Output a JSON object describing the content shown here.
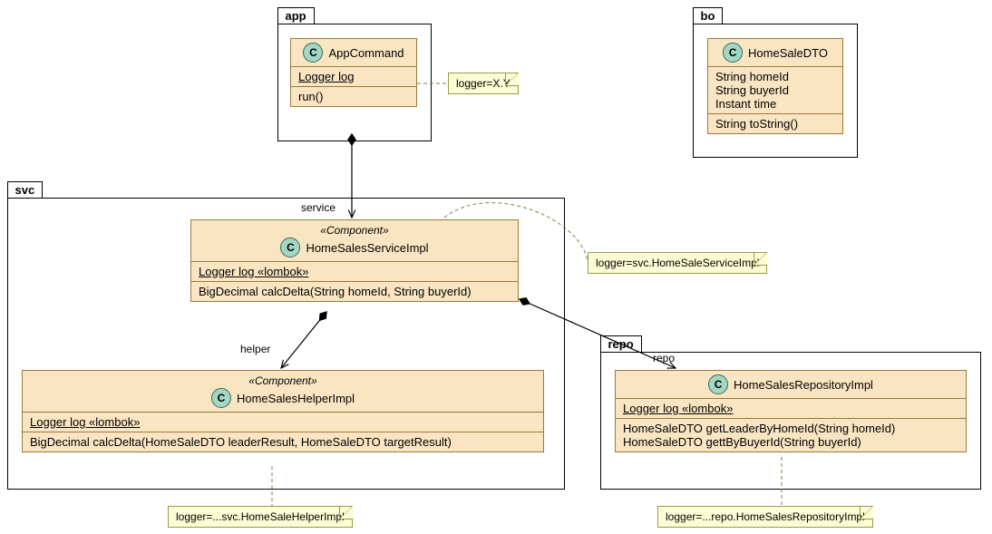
{
  "packages": {
    "app": {
      "label": "app"
    },
    "bo": {
      "label": "bo"
    },
    "svc": {
      "label": "svc"
    },
    "repo": {
      "label": "repo"
    }
  },
  "classes": {
    "AppCommand": {
      "name": "AppCommand",
      "attrs": [
        "Logger log"
      ],
      "ops": [
        "run()"
      ]
    },
    "HomeSaleDTO": {
      "name": "HomeSaleDTO",
      "attrs": [
        "String homeId",
        "String buyerId",
        "Instant time"
      ],
      "ops": [
        "String toString()"
      ]
    },
    "HomeSalesServiceImpl": {
      "stereo": "«Component»",
      "name": "HomeSalesServiceImpl",
      "attrs": [
        "Logger log «lombok»"
      ],
      "ops": [
        "BigDecimal calcDelta(String homeId, String buyerId)"
      ]
    },
    "HomeSalesHelperImpl": {
      "stereo": "«Component»",
      "name": "HomeSalesHelperImpl",
      "attrs": [
        "Logger log «lombok»"
      ],
      "ops": [
        "BigDecimal calcDelta(HomeSaleDTO leaderResult, HomeSaleDTO targetResult)"
      ]
    },
    "HomeSalesRepositoryImpl": {
      "name": "HomeSalesRepositoryImpl",
      "attrs": [
        "Logger log  «lombok»"
      ],
      "ops": [
        "HomeSaleDTO getLeaderByHomeId(String homeId)",
        "HomeSaleDTO gettByBuyerId(String buyerId)"
      ]
    }
  },
  "notes": {
    "n_app": "logger=X.Y",
    "n_svc": "logger=svc.HomeSaleServiceImpl",
    "n_helper": "logger=...svc.HomeSaleHelperImpl",
    "n_repo": "logger=...repo.HomeSalesRepositoryImpl"
  },
  "edges": {
    "service": "service",
    "helper": "helper",
    "repo": "repo"
  },
  "chart_data": {
    "type": "table",
    "description": "UML class diagram",
    "packages": [
      "app",
      "bo",
      "svc",
      "repo"
    ],
    "classes": [
      {
        "package": "app",
        "name": "AppCommand",
        "stereotype": null,
        "fields": [
          "Logger log"
        ],
        "methods": [
          "run()"
        ]
      },
      {
        "package": "bo",
        "name": "HomeSaleDTO",
        "stereotype": null,
        "fields": [
          "String homeId",
          "String buyerId",
          "Instant time"
        ],
        "methods": [
          "String toString()"
        ]
      },
      {
        "package": "svc",
        "name": "HomeSalesServiceImpl",
        "stereotype": "Component",
        "fields": [
          "Logger log «lombok»"
        ],
        "methods": [
          "BigDecimal calcDelta(String homeId, String buyerId)"
        ]
      },
      {
        "package": "svc",
        "name": "HomeSalesHelperImpl",
        "stereotype": "Component",
        "fields": [
          "Logger log «lombok»"
        ],
        "methods": [
          "BigDecimal calcDelta(HomeSaleDTO leaderResult, HomeSaleDTO targetResult)"
        ]
      },
      {
        "package": "repo",
        "name": "HomeSalesRepositoryImpl",
        "stereotype": null,
        "fields": [
          "Logger log  «lombok»"
        ],
        "methods": [
          "HomeSaleDTO getLeaderByHomeId(String homeId)",
          "HomeSaleDTO gettByBuyerId(String buyerId)"
        ]
      }
    ],
    "relations": [
      {
        "from": "AppCommand",
        "to": "HomeSalesServiceImpl",
        "type": "composition",
        "role": "service"
      },
      {
        "from": "HomeSalesServiceImpl",
        "to": "HomeSalesHelperImpl",
        "type": "composition",
        "role": "helper"
      },
      {
        "from": "HomeSalesServiceImpl",
        "to": "HomeSalesRepositoryImpl",
        "type": "composition",
        "role": "repo"
      }
    ],
    "notes": [
      {
        "target": "AppCommand",
        "text": "logger=X.Y"
      },
      {
        "target": "HomeSalesServiceImpl",
        "text": "logger=svc.HomeSaleServiceImpl"
      },
      {
        "target": "HomeSalesHelperImpl",
        "text": "logger=...svc.HomeSaleHelperImpl"
      },
      {
        "target": "HomeSalesRepositoryImpl",
        "text": "logger=...repo.HomeSalesRepositoryImpl"
      }
    ]
  }
}
